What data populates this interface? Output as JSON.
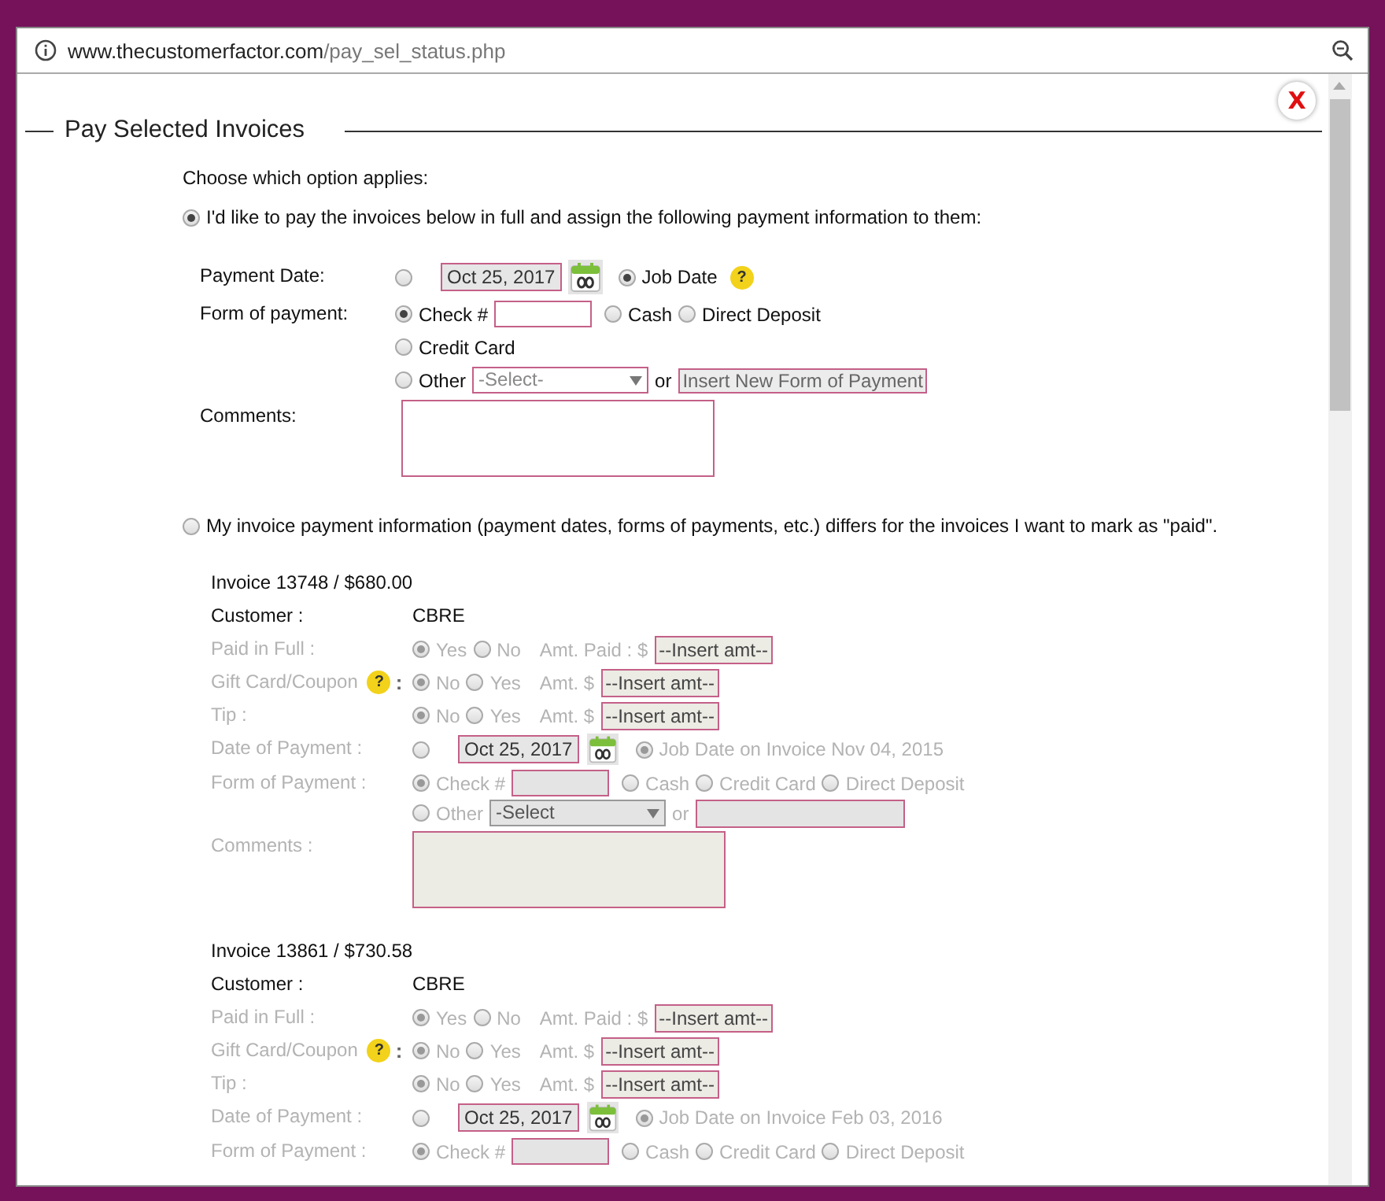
{
  "address_bar": {
    "domain": "www.thecustomerfactor.com",
    "path": "/pay_sel_status.php"
  },
  "dialog": {
    "title": "Pay Selected Invoices",
    "close_label": "X"
  },
  "prompt": "Choose which option applies:",
  "option_full": {
    "selected": true,
    "label": "I'd like to pay the invoices below in full and assign the following payment information to them:"
  },
  "payment_date": {
    "label": "Payment Date:",
    "custom_selected": false,
    "date": "Oct 25, 2017",
    "job_date_selected": true,
    "job_date_label": "Job Date",
    "help": "?"
  },
  "form_of_payment": {
    "label": "Form of payment:",
    "rows": [
      [
        {
          "kind": "text",
          "label": "Check #",
          "selected": true
        },
        {
          "kind": "plain",
          "label": "Cash",
          "selected": false
        },
        {
          "kind": "plain",
          "label": "Direct Deposit",
          "selected": false
        }
      ],
      [
        {
          "kind": "plain",
          "label": "Credit Card",
          "selected": false
        }
      ],
      [
        {
          "kind": "other",
          "label": "Other",
          "selected": false,
          "select": "-Select-",
          "or": "or",
          "new_value": "Insert New Form of Payment"
        }
      ]
    ]
  },
  "comments": {
    "label": "Comments:"
  },
  "option_differs": {
    "selected": false,
    "label": "My invoice payment information (payment dates, forms of payments, etc.) differs for the invoices I want to mark as \"paid\"."
  },
  "invoices": [
    {
      "title": "Invoice 13748 / $680.00",
      "disabled": true,
      "customer_label": "Customer :",
      "customer": "CBRE",
      "choices": [
        {
          "label": "Paid in Full :",
          "options": [
            {
              "label": "Yes",
              "selected": true
            },
            {
              "label": "No",
              "selected": false
            }
          ],
          "amount_label": "Amt. Paid : $",
          "amount": "--Insert amt--"
        },
        {
          "label": "Gift Card/Coupon",
          "help": "?",
          "help_suffix": ":",
          "options": [
            {
              "label": "No",
              "selected": true
            },
            {
              "label": "Yes",
              "selected": false
            }
          ],
          "amount_label": "Amt. $",
          "amount": "--Insert amt--"
        },
        {
          "label": "Tip :",
          "options": [
            {
              "label": "No",
              "selected": true
            },
            {
              "label": "Yes",
              "selected": false
            }
          ],
          "amount_label": "Amt.  $",
          "amount": "--Insert amt--"
        }
      ],
      "date": {
        "label": "Date of Payment :",
        "custom_selected": false,
        "date": "Oct 25, 2017",
        "job_date_selected": true,
        "job_date_label": "Job Date on Invoice Nov 04, 2015"
      },
      "form": {
        "label": "Form of Payment :",
        "options": [
          {
            "label": "Check #",
            "kind": "text",
            "selected": true
          },
          {
            "label": "Cash",
            "kind": "plain",
            "selected": false
          },
          {
            "label": "Credit Card",
            "kind": "plain",
            "selected": false
          },
          {
            "label": "Direct Deposit",
            "kind": "plain",
            "selected": false
          }
        ],
        "other": {
          "label": "Other",
          "selected": false,
          "select": "-Select",
          "or": "or"
        }
      },
      "comments_label": "Comments :"
    },
    {
      "title": "Invoice 13861 / $730.58",
      "disabled": true,
      "customer_label": "Customer :",
      "customer": "CBRE",
      "choices": [
        {
          "label": "Paid in Full :",
          "options": [
            {
              "label": "Yes",
              "selected": true
            },
            {
              "label": "No",
              "selected": false
            }
          ],
          "amount_label": "Amt. Paid : $",
          "amount": "--Insert amt--"
        },
        {
          "label": "Gift Card/Coupon",
          "help": "?",
          "help_suffix": ":",
          "options": [
            {
              "label": "No",
              "selected": true
            },
            {
              "label": "Yes",
              "selected": false
            }
          ],
          "amount_label": "Amt. $",
          "amount": "--Insert amt--"
        },
        {
          "label": "Tip :",
          "options": [
            {
              "label": "No",
              "selected": true
            },
            {
              "label": "Yes",
              "selected": false
            }
          ],
          "amount_label": "Amt.  $",
          "amount": "--Insert amt--"
        }
      ],
      "date": {
        "label": "Date of Payment :",
        "custom_selected": false,
        "date": "Oct 25, 2017",
        "job_date_selected": true,
        "job_date_label": "Job Date on Invoice Feb 03, 2016"
      },
      "form": {
        "label": "Form of Payment :",
        "options": [
          {
            "label": "Check #",
            "kind": "text",
            "selected": true
          },
          {
            "label": "Cash",
            "kind": "plain",
            "selected": false
          },
          {
            "label": "Credit Card",
            "kind": "plain",
            "selected": false
          },
          {
            "label": "Direct Deposit",
            "kind": "plain",
            "selected": false
          }
        ]
      }
    }
  ]
}
